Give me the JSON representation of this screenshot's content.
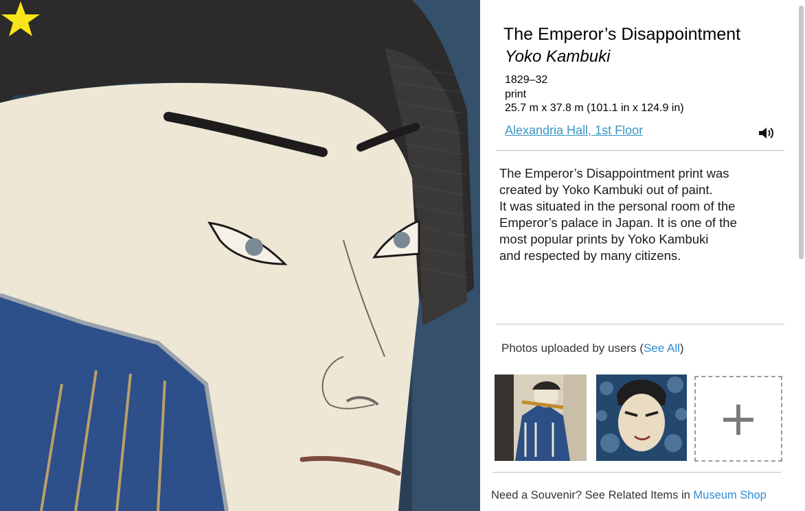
{
  "artwork": {
    "favorite_icon": "star-icon",
    "favorite_color": "#f7e51a"
  },
  "details": {
    "title": "The Emperor’s Disappointment",
    "artist": "Yoko Kambuki",
    "date": "1829–32",
    "medium": "print",
    "dimensions": "25.7 m x 37.8 m (101.1 in x 124.9 in)",
    "location_link": "Alexandria Hall, 1st Floor",
    "audio_icon": "speaker-icon"
  },
  "description": {
    "lines": [
      "The Emperor’s Disappointment print was",
      "created by Yoko Kambuki out of paint.",
      "It was situated in the personal room of the",
      "Emperor’s palace in Japan. It is one of the",
      "most popular prints by Yoko Kambuki",
      "and respected by many citizens."
    ]
  },
  "user_photos": {
    "heading_prefix": "Photos uploaded by users (",
    "see_all": "See All",
    "heading_suffix": ")",
    "add_label": "+"
  },
  "souvenir": {
    "text": "Need a Souvenir? See Related Items in ",
    "link": "Museum Shop"
  },
  "colors": {
    "link": "#3a97c4",
    "accent_link": "#2f8ad1"
  }
}
